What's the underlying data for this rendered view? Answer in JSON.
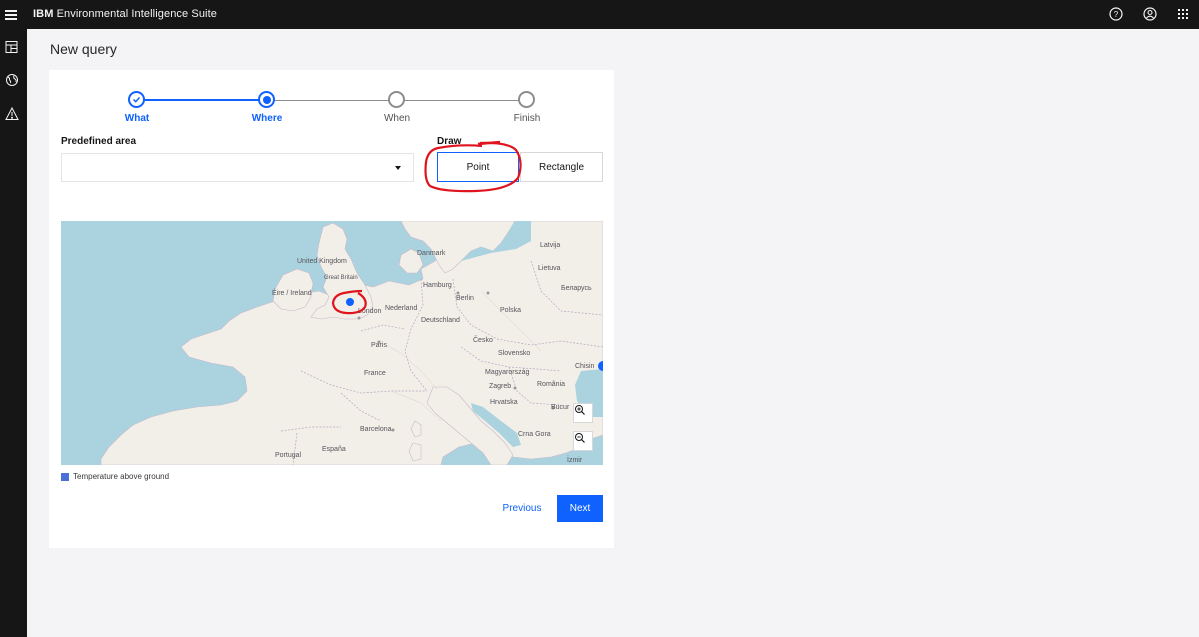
{
  "header": {
    "brand": "IBM",
    "product": "Environmental Intelligence Suite",
    "icons": [
      "menu-icon",
      "help-icon",
      "user-icon",
      "app-switcher-icon"
    ]
  },
  "siderail": {
    "icons": [
      "dashboard-icon",
      "globe-icon",
      "alert-icon"
    ]
  },
  "page": {
    "title": "New query"
  },
  "steps": [
    {
      "label": "What",
      "state": "complete"
    },
    {
      "label": "Where",
      "state": "current"
    },
    {
      "label": "When",
      "state": "incomplete"
    },
    {
      "label": "Finish",
      "state": "incomplete"
    }
  ],
  "predefined_area": {
    "label": "Predefined area",
    "value": ""
  },
  "draw": {
    "label": "Draw",
    "point_label": "Point",
    "rectangle_label": "Rectangle",
    "selected": "Point"
  },
  "map": {
    "labels": {
      "united_kingdom": "United Kingdom",
      "great_britain": "Great Britain",
      "eire": "Éire / Ireland",
      "london": "London",
      "danmark": "Danmark",
      "latvija": "Latvija",
      "lietuva": "Lietuva",
      "hamburg": "Hamburg",
      "berlin": "Berlin",
      "belarus": "Беларусь",
      "nederland": "Nederland",
      "polska": "Polska",
      "deutschland": "Deutschland",
      "cesko": "Česko",
      "paris": "Paris",
      "slovensko": "Slovensko",
      "france": "France",
      "magyarorszag": "Magyarország",
      "zagreb": "Zagreb",
      "romania": "România",
      "hrvatska": "Hrvatska",
      "bucur": "Bucur",
      "barcelona": "Barcelona",
      "espana": "España",
      "portugal": "Portugal",
      "crnagora": "Crna Gora",
      "chisin": "Chisin",
      "izmir": "İzmir"
    }
  },
  "legend": {
    "label": "Temperature above ground",
    "color": "#4a6fd6"
  },
  "actions": {
    "previous": "Previous",
    "next": "Next"
  },
  "colors": {
    "accent": "#0f62fe",
    "annotation": "#e0141e",
    "water": "#aad3df",
    "land": "#f2efe9"
  }
}
